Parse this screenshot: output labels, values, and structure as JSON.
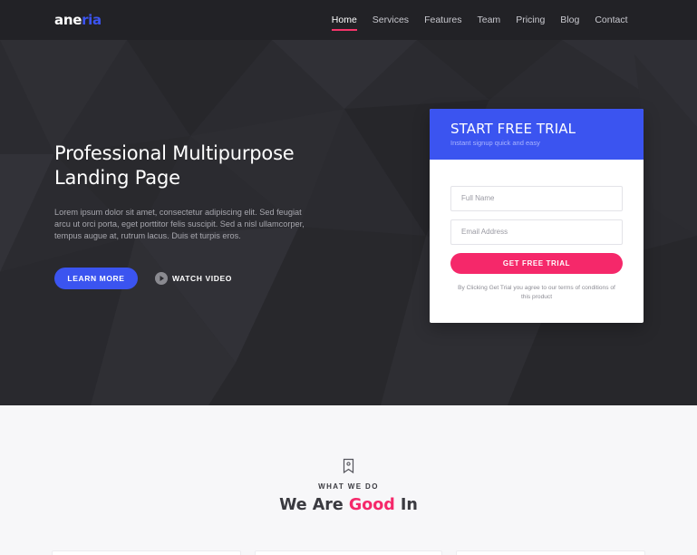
{
  "brand": {
    "logo_main": "ane",
    "logo_accent": "ria",
    "accent_color": "#3b54f0",
    "pink_color": "#f5286a"
  },
  "nav": {
    "items": [
      {
        "label": "Home",
        "active": true
      },
      {
        "label": "Services",
        "active": false
      },
      {
        "label": "Features",
        "active": false
      },
      {
        "label": "Team",
        "active": false
      },
      {
        "label": "Pricing",
        "active": false
      },
      {
        "label": "Blog",
        "active": false
      },
      {
        "label": "Contact",
        "active": false
      }
    ]
  },
  "hero": {
    "title": "Professional Multipurpose Landing Page",
    "description": "Lorem ipsum dolor sit amet, consectetur adipiscing elit. Sed feugiat arcu ut orci porta, eget porttitor felis suscipit. Sed a nisl ullamcorper, tempus augue at, rutrum lacus. Duis et turpis eros.",
    "learn_more_label": "LEARN MORE",
    "watch_video_label": "WATCH VIDEO",
    "watch_icon": "play-icon"
  },
  "trial_form": {
    "title": "START FREE TRIAL",
    "subtitle": "Instant signup quick and easy",
    "name_placeholder": "Full Name",
    "email_placeholder": "Email Address",
    "submit_label": "GET FREE TRIAL",
    "note": "By Clicking Get Trial you agree to our terms of conditions of this product"
  },
  "section": {
    "icon": "bookmark-icon",
    "eyebrow": "WHAT WE DO",
    "title_start": "We Are ",
    "title_highlight": "Good",
    "title_end": " In"
  }
}
